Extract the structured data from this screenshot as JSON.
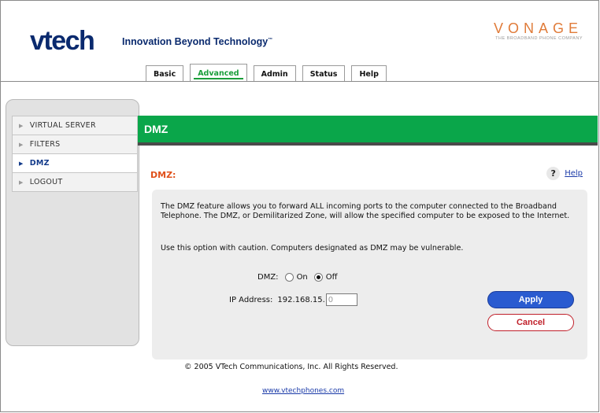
{
  "header": {
    "logo": "vtech",
    "tagline": "Innovation Beyond Technology",
    "tagline_tm": "™",
    "partner_logo": "VONAGE",
    "partner_subtitle": "THE BROADBAND PHONE COMPANY"
  },
  "tabs": [
    {
      "label": "Basic",
      "active": false
    },
    {
      "label": "Advanced",
      "active": true
    },
    {
      "label": "Admin",
      "active": false
    },
    {
      "label": "Status",
      "active": false
    },
    {
      "label": "Help",
      "active": false
    }
  ],
  "sidebar": {
    "items": [
      {
        "label": "VIRTUAL SERVER",
        "active": false
      },
      {
        "label": "FILTERS",
        "active": false
      },
      {
        "label": "DMZ",
        "active": true
      },
      {
        "label": "LOGOUT",
        "active": false
      }
    ]
  },
  "main": {
    "banner_title": "DMZ",
    "section_title": "DMZ:",
    "help_icon_glyph": "?",
    "help_label": "Help",
    "description_1": "The DMZ feature allows you to forward ALL incoming ports to the computer connected to the Broadband Telephone. The DMZ, or Demilitarized Zone, will allow the specified computer to be exposed to the Internet.",
    "description_2": "Use this option with caution. Computers designated as DMZ may be vulnerable.",
    "dmz_label": "DMZ:",
    "dmz_on_label": "On",
    "dmz_off_label": "Off",
    "dmz_selected": "Off",
    "ip_label": "IP Address:",
    "ip_prefix": "192.168.15.",
    "ip_last_octet": "0",
    "apply_label": "Apply",
    "cancel_label": "Cancel"
  },
  "footer": {
    "copyright": "© 2005 VTech Communications, Inc. All Rights Reserved.",
    "link": "www.vtechphones.com"
  },
  "colors": {
    "banner_green": "#0aa64a",
    "active_tab_green": "#1a9e3a",
    "section_title_orange": "#e0501a",
    "apply_blue": "#2a5bd0",
    "cancel_red": "#c0202a",
    "vtech_navy": "#0a2a6e",
    "vonage_orange": "#e07b39"
  }
}
